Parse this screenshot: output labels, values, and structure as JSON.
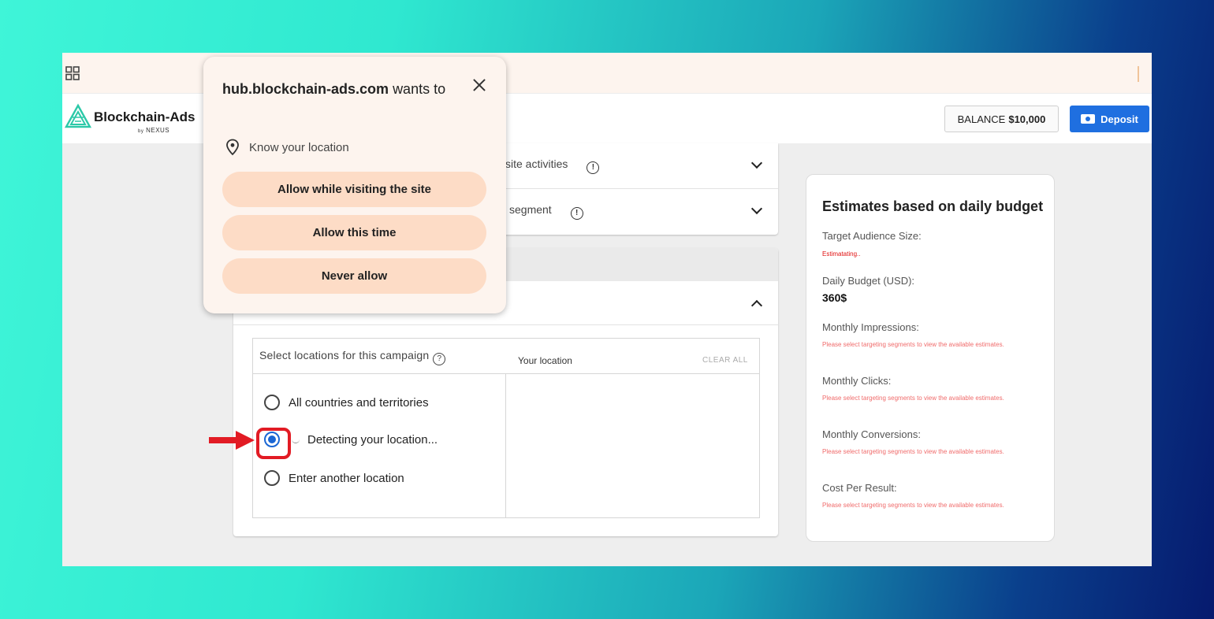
{
  "header": {
    "logo_text": "Blockchain-Ads",
    "logo_by": "by",
    "logo_sub": "NEXUS",
    "balance_label": "BALANCE",
    "balance_value": "$10,000",
    "deposit_label": "Deposit"
  },
  "targeting_rows": [
    {
      "label": "site activities"
    },
    {
      "label": "segment"
    }
  ],
  "location": {
    "title": "Select locations for this campaign",
    "options": [
      {
        "label": "All countries and territories",
        "selected": false
      },
      {
        "label": "Detecting your location...",
        "selected": true
      },
      {
        "label": "Enter another location",
        "selected": false
      }
    ],
    "right_label": "Your location",
    "clear_all": "CLEAR ALL"
  },
  "estimates": {
    "title": "Estimates based on daily budget",
    "audience_label": "Target Audience Size:",
    "audience_status": "Estimatating..",
    "budget_label": "Daily Budget (USD):",
    "budget_value": "360$",
    "impressions_label": "Monthly Impressions:",
    "clicks_label": "Monthly Clicks:",
    "conversions_label": "Monthly Conversions:",
    "cpr_label": "Cost Per Result:",
    "note": "Please select targeting segments to view the available estimates."
  },
  "permission_popup": {
    "site": "hub.blockchain-ads.com",
    "title_suffix": "wants to",
    "permission": "Know your location",
    "buttons": [
      "Allow while visiting the site",
      "Allow this time",
      "Never allow"
    ]
  },
  "colors": {
    "accent": "#1f6fe0",
    "highlight": "#e21b24",
    "popup_bg": "#fdf4ee",
    "popup_button": "#fddcc6",
    "estimate_error": "#e01010"
  }
}
